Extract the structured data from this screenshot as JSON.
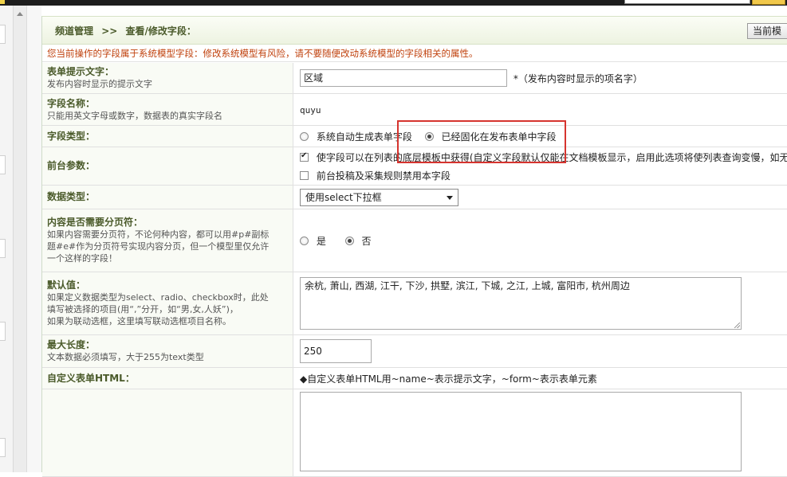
{
  "header": {
    "breadcrumb_root": "频道管理",
    "breadcrumb_sep": ">>",
    "breadcrumb_current": "查看/修改字段：",
    "current_button": "当前模"
  },
  "warning": "您当前操作的字段属于系统模型字段：修改系统模型有风险，请不要随便改动系统模型的字段相关的属性。",
  "fields": {
    "prompt": {
      "title": "表单提示文字：",
      "desc": "发布内容时显示的提示文字",
      "value": "区域",
      "hint": "*（发布内容时显示的项名字）"
    },
    "name": {
      "title": "字段名称：",
      "desc": "只能用英文字母或数字，数据表的真实字段名",
      "value": "quyu"
    },
    "type": {
      "title": "字段类型：",
      "option1": "系统自动生成表单字段",
      "option2": "已经固化在发布表单中字段",
      "selected": "option2"
    },
    "frontend": {
      "title": "前台参数：",
      "check1": "使字段可以在列表的底层模板中获得(自定义字段默认仅能在文档模板显示，启用此选项将使列表查询变慢，如无必要",
      "check1_checked": true,
      "check2": "前台投稿及采集规则禁用本字段",
      "check2_checked": false
    },
    "datatype": {
      "title": "数据类型：",
      "selected": "使用select下拉框"
    },
    "pagebreak": {
      "title": "内容是否需要分页符：",
      "desc_line1": "如果内容需要分页符，不论何种内容，都可以用#p#副标",
      "desc_line2": "题#e#作为分页符号实现内容分页，但一个模型里仅允许",
      "desc_line3": "一个这样的字段！",
      "yes": "是",
      "no": "否",
      "selected": "no"
    },
    "default": {
      "title": "默认值：",
      "desc_line1": "如果定义数据类型为select、radio、checkbox时，此处",
      "desc_line2": "填写被选择的项目(用“,”分开，如“男,女,人妖”)，",
      "desc_line3": "如果为联动选框，这里填写联动选框项目名称。",
      "value": "余杭, 萧山, 西湖, 江干, 下沙, 拱墅, 滨江, 下城, 之江, 上城, 富阳市, 杭州周边"
    },
    "maxlength": {
      "title": "最大长度：",
      "desc": "文本数据必须填写，大于255为text类型",
      "value": "250"
    },
    "customhtml": {
      "title": "自定义表单HTML：",
      "hint": "◆自定义表单HTML用~name~表示提示文字，~form~表示表单元素",
      "value": ""
    }
  },
  "colors": {
    "label_text": "#4a5a2a",
    "warning_text": "#c0420e",
    "highlight_border": "#d6342f"
  }
}
